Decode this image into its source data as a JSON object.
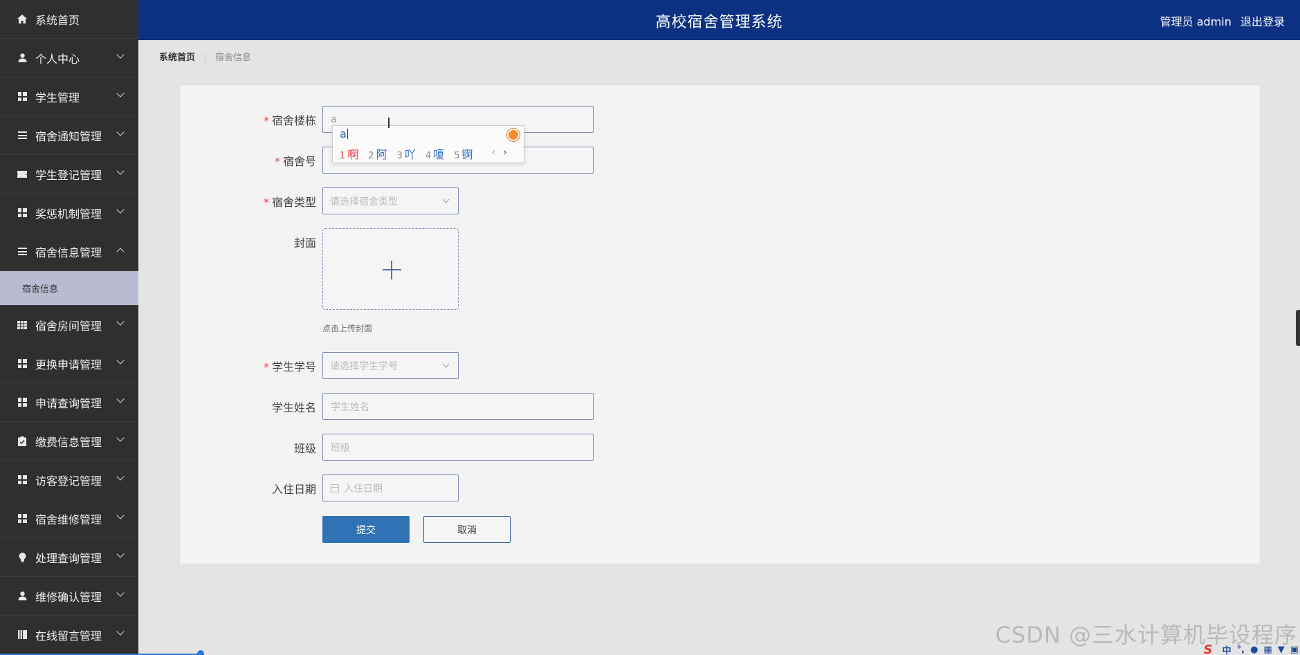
{
  "app": {
    "title": "高校宿舍管理系统",
    "user_label": "管理员 admin",
    "logout_label": "退出登录"
  },
  "sidebar": {
    "items": [
      {
        "label": "系统首页",
        "icon": "home-icon"
      },
      {
        "label": "个人中心",
        "icon": "user-icon"
      },
      {
        "label": "学生管理",
        "icon": "grid-icon"
      },
      {
        "label": "宿舍通知管理",
        "icon": "list-icon"
      },
      {
        "label": "学生登记管理",
        "icon": "ticket-icon"
      },
      {
        "label": "奖惩机制管理",
        "icon": "grid-icon"
      },
      {
        "label": "宿舍信息管理",
        "icon": "list-icon"
      },
      {
        "label": "宿舍房间管理",
        "icon": "table-icon"
      },
      {
        "label": "更换申请管理",
        "icon": "grid-icon"
      },
      {
        "label": "申请查询管理",
        "icon": "grid-icon"
      },
      {
        "label": "缴费信息管理",
        "icon": "clipboard-icon"
      },
      {
        "label": "访客登记管理",
        "icon": "grid-icon"
      },
      {
        "label": "宿舍维修管理",
        "icon": "grid-icon"
      },
      {
        "label": "处理查询管理",
        "icon": "bulb-icon"
      },
      {
        "label": "维修确认管理",
        "icon": "user-icon"
      },
      {
        "label": "在线留言管理",
        "icon": "book-icon"
      }
    ],
    "sub_item": "宿舍信息"
  },
  "breadcrumb": {
    "home": "系统首页",
    "current": "宿舍信息"
  },
  "form": {
    "building": {
      "label": "宿舍楼栋",
      "value": "a"
    },
    "room_no": {
      "label": "宿舍号"
    },
    "room_type": {
      "label": "宿舍类型",
      "placeholder": "请选择宿舍类型"
    },
    "cover": {
      "label": "封面",
      "hint": "点击上传封面"
    },
    "student_id": {
      "label": "学生学号",
      "placeholder": "请选择学生学号"
    },
    "student_name": {
      "label": "学生姓名",
      "placeholder": "学生姓名"
    },
    "class": {
      "label": "班级",
      "placeholder": "班级"
    },
    "checkin_date": {
      "label": "入住日期",
      "placeholder": "入住日期"
    },
    "submit_label": "提交",
    "cancel_label": "取消"
  },
  "ime": {
    "composition": "a",
    "candidates": [
      {
        "n": "1",
        "text": "啊"
      },
      {
        "n": "2",
        "text": "阿"
      },
      {
        "n": "3",
        "text": "吖"
      },
      {
        "n": "4",
        "text": "嗄"
      },
      {
        "n": "5",
        "text": "锕"
      }
    ],
    "prev": "‹",
    "next": "›"
  },
  "watermark": "CSDN @三水计算机毕设程序",
  "ime_bar": {
    "logo": "S",
    "mode": "中",
    "punct": "°,"
  },
  "colors": {
    "header_bg": "#0c3182",
    "sidebar_bg": "#2f2f2f",
    "sidebar_active_sub": "#b9bcd1",
    "primary": "#2f73b5",
    "required_star": "#e0454a"
  }
}
